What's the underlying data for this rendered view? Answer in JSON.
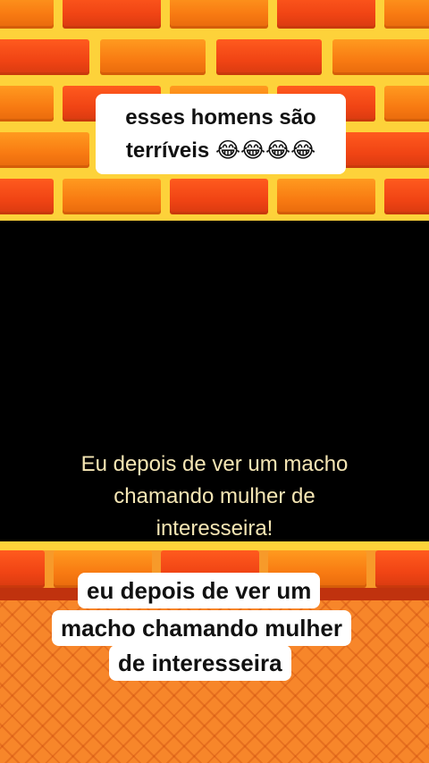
{
  "top_sticker": {
    "line1": "esses homens são",
    "line2": "terríveis 😂😂😂😂"
  },
  "video": {
    "caption_line1": "Eu depois de ver um macho",
    "caption_line2": "chamando mulher de",
    "caption_line3": "interesseira!"
  },
  "bottom_sticker": {
    "line1": "eu depois de ver um",
    "line2": "macho chamando mulher",
    "line3": "de interesseira"
  },
  "colors": {
    "brick_orange": "#f87a12",
    "brick_red": "#f04414",
    "mortar_yellow": "#fdd23a",
    "caption_text": "#f5e6b4"
  }
}
